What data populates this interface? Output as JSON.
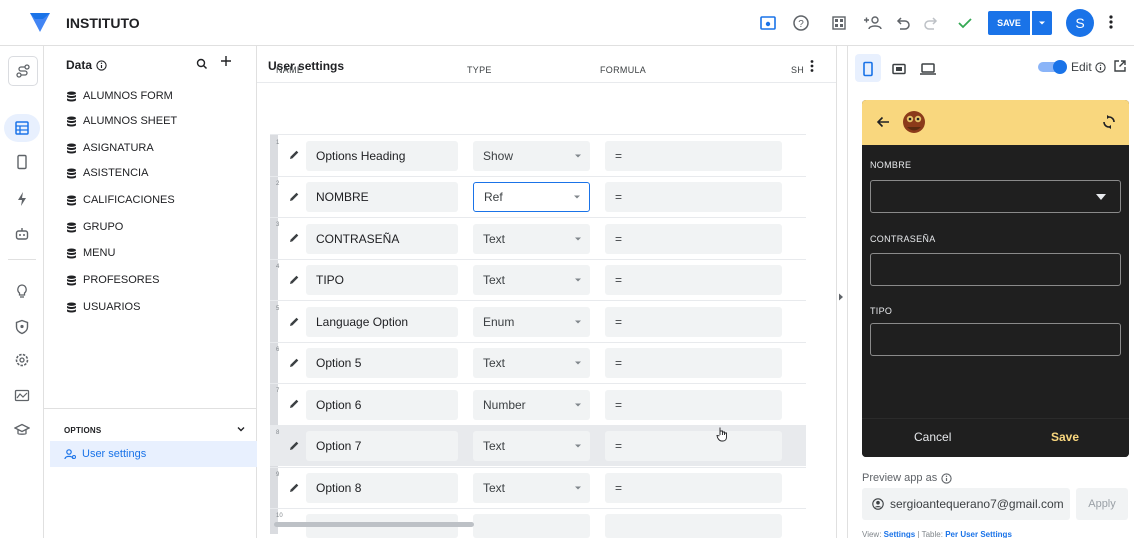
{
  "app": {
    "title": "INSTITUTO"
  },
  "topbar": {
    "save_label": "SAVE",
    "avatar_initial": "S"
  },
  "data_panel": {
    "header": "Data",
    "tables": [
      "ALUMNOS FORM",
      "ALUMNOS SHEET",
      "ASIGNATURA",
      "ASISTENCIA",
      "CALIFICACIONES",
      "GRUPO",
      "MENU",
      "PROFESORES",
      "USUARIOS"
    ],
    "options_label": "OPTIONS",
    "user_settings_label": "User settings"
  },
  "main": {
    "title": "User settings",
    "columns": [
      "NAME",
      "TYPE",
      "FORMULA",
      "SH"
    ],
    "rows": [
      {
        "num": "1",
        "name": "Options Heading",
        "type": "Show",
        "formula": "="
      },
      {
        "num": "2",
        "name": "NOMBRE",
        "type": "Ref",
        "formula": "="
      },
      {
        "num": "3",
        "name": "CONTRASEÑA",
        "type": "Text",
        "formula": "="
      },
      {
        "num": "4",
        "name": "TIPO",
        "type": "Text",
        "formula": "="
      },
      {
        "num": "5",
        "name": "Language Option",
        "type": "Enum",
        "formula": "="
      },
      {
        "num": "6",
        "name": "Option 5",
        "type": "Text",
        "formula": "="
      },
      {
        "num": "7",
        "name": "Option 6",
        "type": "Number",
        "formula": "="
      },
      {
        "num": "8",
        "name": "Option 7",
        "type": "Text",
        "formula": "="
      },
      {
        "num": "9",
        "name": "Option 8",
        "type": "Text",
        "formula": "="
      },
      {
        "num": "10",
        "name": "",
        "type": "",
        "formula": ""
      }
    ]
  },
  "preview": {
    "edit_label": "Edit",
    "phone": {
      "fields": [
        "NOMBRE",
        "CONTRASEÑA",
        "TIPO"
      ],
      "cancel_label": "Cancel",
      "save_label": "Save"
    },
    "preview_as_label": "Preview app as",
    "email": "sergioantequerano7@gmail.com",
    "apply_label": "Apply",
    "footer_view_label": "View:",
    "footer_view_value": "Settings",
    "footer_sep": "|",
    "footer_table_label": "Table:",
    "footer_table_value": "Per User Settings"
  },
  "colors": {
    "accent": "#1a73e8",
    "phone_header": "#f9d77e",
    "phone_bg": "#1f1f1f"
  }
}
